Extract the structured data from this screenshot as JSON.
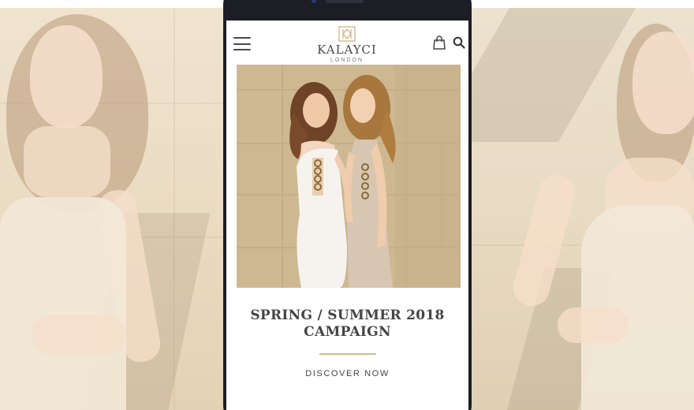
{
  "brand": {
    "name": "KALAYCI",
    "location": "LONDON",
    "accent_color": "#d7b98a"
  },
  "header": {
    "menu_icon": "hamburger-menu-icon",
    "bag_icon": "shopping-bag-icon",
    "search_icon": "search-icon"
  },
  "hero": {
    "image": "two-models-campaign-photo"
  },
  "campaign": {
    "title_line1": "SPRING / SUMMER 2018",
    "title_line2": "CAMPAIGN",
    "cta_label": "DISCOVER NOW"
  },
  "background": {
    "left_image": "model-campaign-photo-faded",
    "right_image": "model-campaign-photo-faded"
  }
}
